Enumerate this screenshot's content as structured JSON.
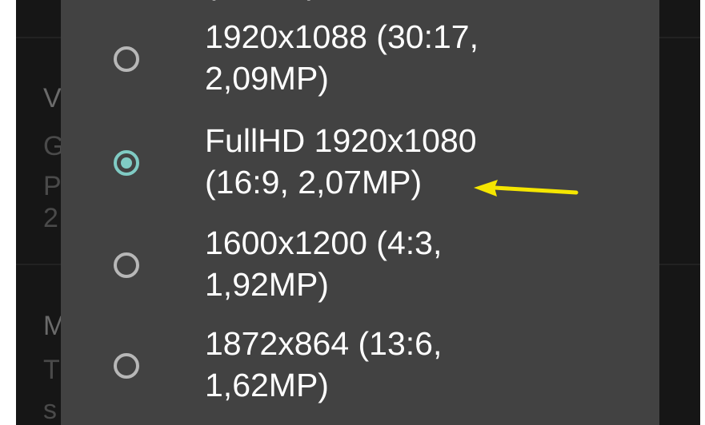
{
  "background_fragments": [
    {
      "id": "frag-v",
      "text": "V",
      "kind": "title"
    },
    {
      "id": "frag-g",
      "text": "G",
      "kind": "body"
    },
    {
      "id": "frag-p",
      "text": "P",
      "kind": "body"
    },
    {
      "id": "frag-2",
      "text": "2",
      "kind": "body"
    },
    {
      "id": "frag-m",
      "text": "M",
      "kind": "title"
    },
    {
      "id": "frag-t",
      "text": "T",
      "kind": "body"
    },
    {
      "id": "frag-s",
      "text": "s",
      "kind": "body"
    }
  ],
  "dialog": {
    "options": [
      {
        "line1": "1920x1088 (30:17,",
        "line2": "2,09MP)",
        "selected": false
      },
      {
        "line1": "FullHD 1920x1080",
        "line2": "(16:9, 2,07MP)",
        "selected": true
      },
      {
        "line1": "1600x1200 (4:3,",
        "line2": "1,92MP)",
        "selected": false
      },
      {
        "line1": "1872x864 (13:6,",
        "line2": "1,62MP)",
        "selected": false
      }
    ]
  },
  "colors": {
    "dialog_bg": "#424242",
    "radio_selected": "#80cbc4",
    "radio_unselected": "#b7b7b7",
    "arrow": "#f5e600"
  },
  "annotation": {
    "icon": "arrow-left-icon",
    "points_to": "FullHD 1920x1080"
  }
}
